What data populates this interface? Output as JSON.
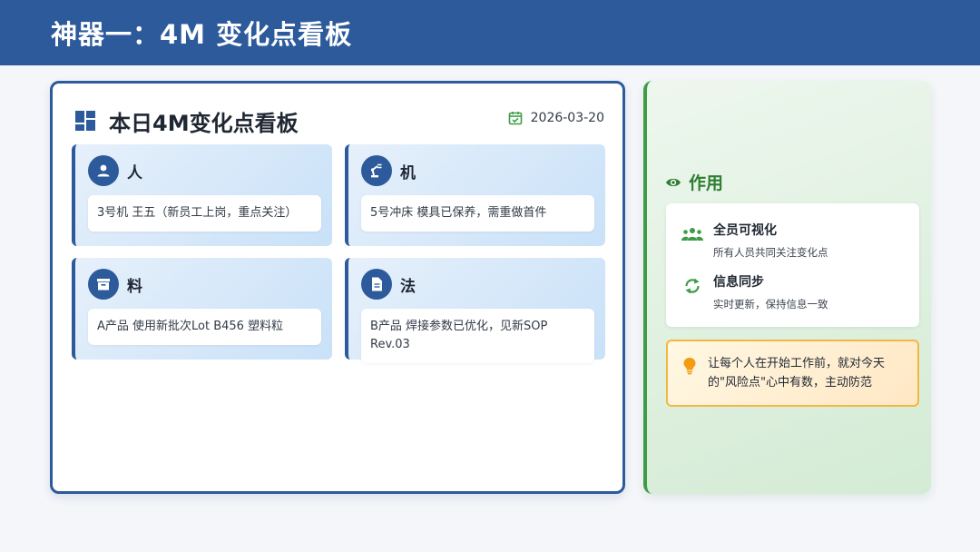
{
  "header": {
    "title": "神器一：4M 变化点看板"
  },
  "board": {
    "title": "本日4M变化点看板",
    "date": "2026-03-20",
    "cards": [
      {
        "label": "人",
        "icon": "person-icon",
        "text": "3号机 王五（新员工上岗，重点关注）"
      },
      {
        "label": "机",
        "icon": "robot-arm-icon",
        "text": "5号冲床 模具已保养，需重做首件"
      },
      {
        "label": "料",
        "icon": "archive-box-icon",
        "text": "A产品 使用新批次Lot B456 塑料粒"
      },
      {
        "label": "法",
        "icon": "document-icon",
        "text": "B产品 焊接参数已优化，见新SOP Rev.03"
      }
    ]
  },
  "side": {
    "title": "作用",
    "effects": [
      {
        "title": "全员可视化",
        "desc": "所有人员共同关注变化点",
        "icon": "group-icon"
      },
      {
        "title": "信息同步",
        "desc": "实时更新，保持信息一致",
        "icon": "sync-icon"
      }
    ],
    "note": "让每个人在开始工作前，就对今天的\"风险点\"心中有数，主动防范"
  },
  "colors": {
    "primary": "#2c5a9b",
    "green": "#3e9c46",
    "amber": "#f5b642"
  }
}
